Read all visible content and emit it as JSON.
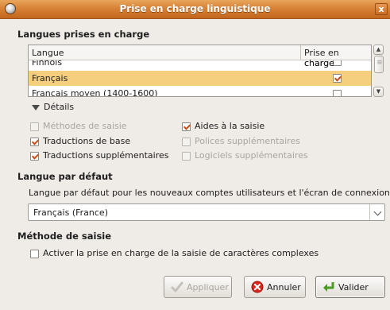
{
  "window": {
    "title": "Prise en charge linguistique",
    "close_glyph": "x"
  },
  "languages": {
    "heading": "Langues prises en charge",
    "columns": {
      "lang": "Langue",
      "support": "Prise en charge"
    },
    "rows": [
      {
        "name": "Finnois",
        "checked": false,
        "selected": false
      },
      {
        "name": "Français",
        "checked": true,
        "selected": true
      },
      {
        "name": "Français moyen (1400-1600)",
        "checked": false,
        "selected": false
      }
    ]
  },
  "details": {
    "label": "Détails",
    "options": [
      {
        "label": "Méthodes de saisie",
        "checked": false,
        "enabled": false
      },
      {
        "label": "Traductions de base",
        "checked": true,
        "enabled": true
      },
      {
        "label": "Traductions supplémentaires",
        "checked": true,
        "enabled": true
      },
      {
        "label": "Aides à la saisie",
        "checked": true,
        "enabled": true
      },
      {
        "label": "Polices supplémentaires",
        "checked": false,
        "enabled": false
      },
      {
        "label": "Logiciels supplémentaires",
        "checked": false,
        "enabled": false
      }
    ]
  },
  "default_language": {
    "heading": "Langue par défaut",
    "description": "Langue par défaut pour les nouveaux comptes utilisateurs et l'écran de connexion :",
    "selected": "Français (France)"
  },
  "input_method": {
    "heading": "Méthode de saisie",
    "complex_label": "Activer la prise en charge de la saisie de caractères complexes",
    "complex_checked": false
  },
  "buttons": {
    "apply": "Appliquer",
    "cancel": "Annuler",
    "ok": "Valider"
  },
  "colors": {
    "title_bar": "#d78237",
    "selection": "#f6cf7e",
    "check": "#c7501b"
  }
}
